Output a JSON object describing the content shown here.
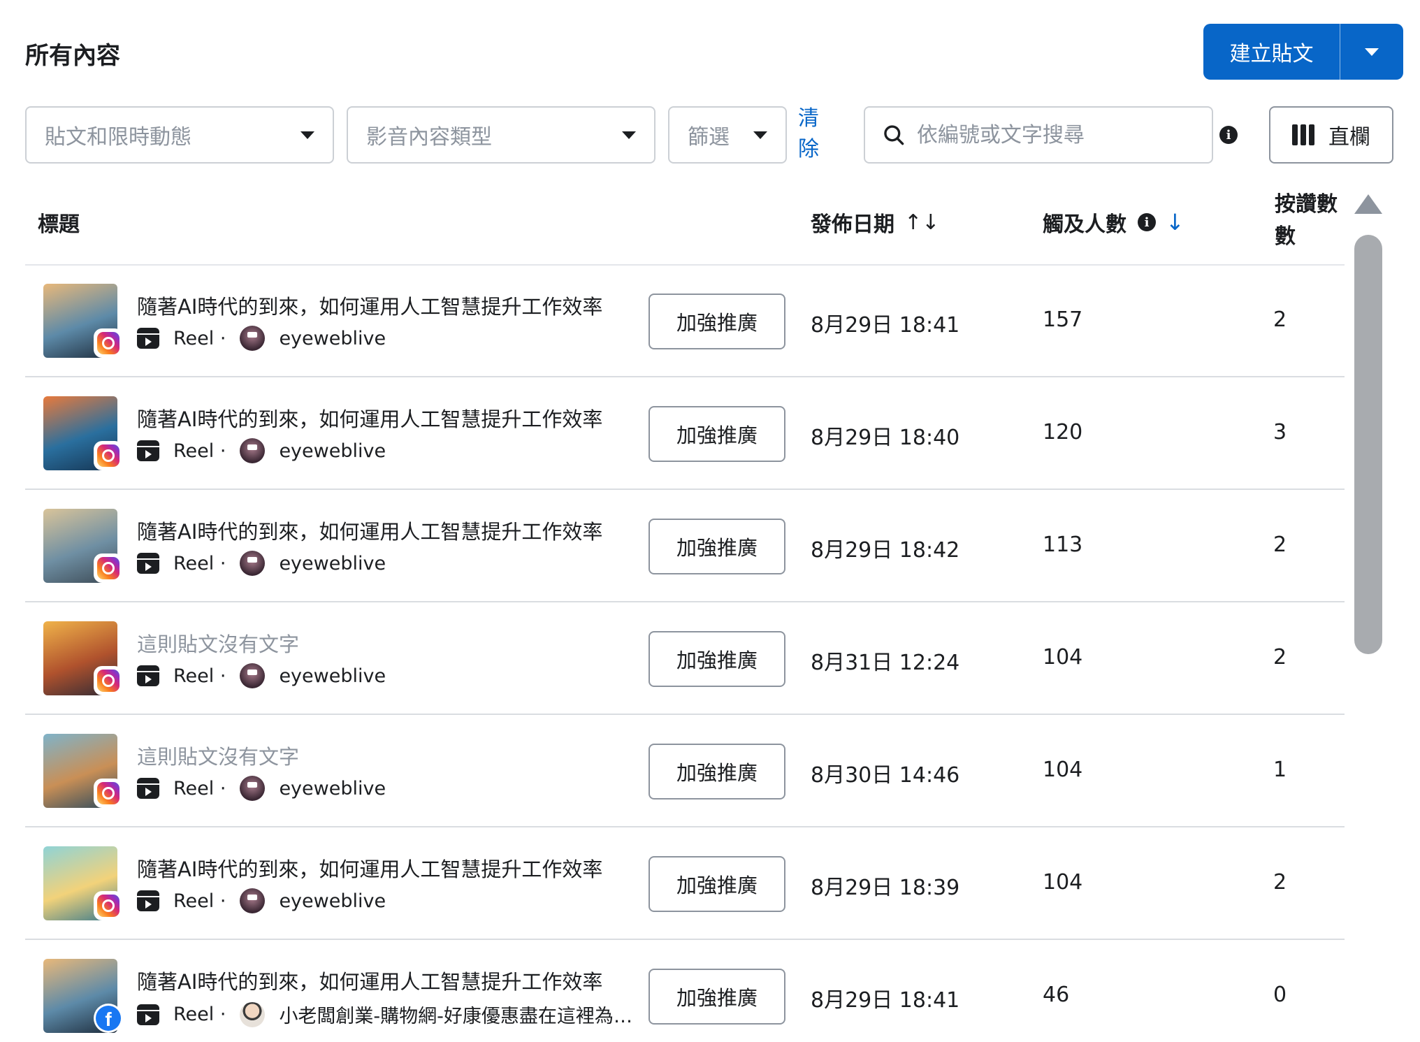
{
  "page_title": "所有內容",
  "create_post": {
    "label": "建立貼文"
  },
  "filters": {
    "post_type": "貼文和限時動態",
    "media_type": "影音內容類型",
    "filter": "篩選",
    "clear": "清除"
  },
  "search": {
    "placeholder": "依編號或文字搜尋",
    "value": ""
  },
  "columns_button": "直欄",
  "table": {
    "headers": {
      "title": "標題",
      "date": "發佈日期",
      "reach": "觸及人數",
      "likes": "按讚數 數"
    },
    "sort_date_glyph": "↑↓",
    "sort_reach_glyph": "↓",
    "boost_label": "加強推廣",
    "reel_label": "Reel ·",
    "rows": [
      {
        "title": "隨著AI時代的到來，如何運用人工智慧提升工作效率",
        "muted": false,
        "platform": "instagram",
        "account": "eyeweblive",
        "date": "8月29日 18:41",
        "reach": "157",
        "likes": "2",
        "thumb_colors": [
          "#e8b87a",
          "#5d8aa8",
          "#1e2d3d"
        ]
      },
      {
        "title": "隨著AI時代的到來，如何運用人工智慧提升工作效率",
        "muted": false,
        "platform": "instagram",
        "account": "eyeweblive",
        "date": "8月29日 18:40",
        "reach": "120",
        "likes": "3",
        "thumb_colors": [
          "#e87a3c",
          "#2a6f9e",
          "#153452"
        ]
      },
      {
        "title": "隨著AI時代的到來，如何運用人工智慧提升工作效率",
        "muted": false,
        "platform": "instagram",
        "account": "eyeweblive",
        "date": "8月29日 18:42",
        "reach": "113",
        "likes": "2",
        "thumb_colors": [
          "#d9c49a",
          "#6f8fa3",
          "#3c4a55"
        ]
      },
      {
        "title": "這則貼文沒有文字",
        "muted": true,
        "platform": "instagram",
        "account": "eyeweblive",
        "date": "8月31日 12:24",
        "reach": "104",
        "likes": "2",
        "thumb_colors": [
          "#f0b34a",
          "#b0522d",
          "#2f2a35"
        ]
      },
      {
        "title": "這則貼文沒有文字",
        "muted": true,
        "platform": "instagram",
        "account": "eyeweblive",
        "date": "8月30日 14:46",
        "reach": "104",
        "likes": "1",
        "thumb_colors": [
          "#7fb3c9",
          "#c98f56",
          "#2d4a5c"
        ]
      },
      {
        "title": "隨著AI時代的到來，如何運用人工智慧提升工作效率",
        "muted": false,
        "platform": "instagram",
        "account": "eyeweblive",
        "date": "8月29日 18:39",
        "reach": "104",
        "likes": "2",
        "thumb_colors": [
          "#8fd3d6",
          "#f2d27a",
          "#3a7a8c"
        ]
      },
      {
        "title": "隨著AI時代的到來，如何運用人工智慧提升工作效率",
        "muted": false,
        "platform": "facebook",
        "account": "小老闆創業-購物網-好康優惠盡在這裡為你服務",
        "date": "8月29日 18:41",
        "reach": "46",
        "likes": "0",
        "thumb_colors": [
          "#e8b87a",
          "#5d8aa8",
          "#1e2d3d"
        ]
      }
    ]
  },
  "colors": {
    "primary": "#0866c8",
    "border": "#ccd0d5",
    "muted_text": "#8d949e"
  }
}
